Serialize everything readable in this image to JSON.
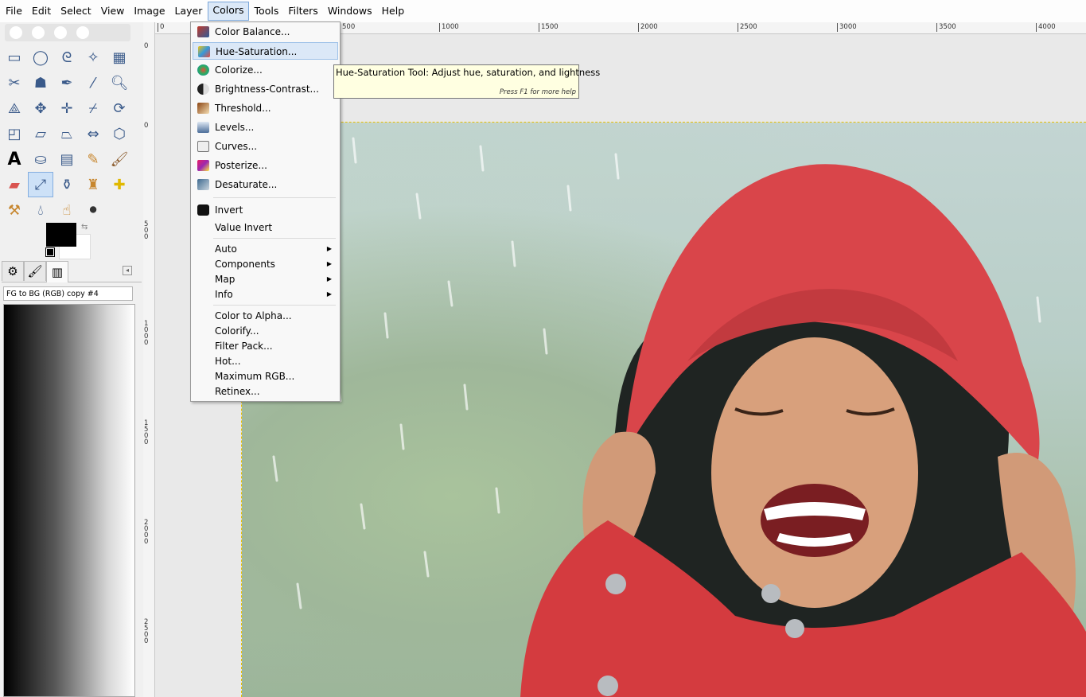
{
  "menubar": [
    "File",
    "Edit",
    "Select",
    "View",
    "Image",
    "Layer",
    "Colors",
    "Tools",
    "Filters",
    "Windows",
    "Help"
  ],
  "ruler_h": [
    "0",
    "500",
    "1000",
    "1500",
    "2000",
    "2500",
    "3000",
    "3500",
    "4000"
  ],
  "ruler_v": [
    "0",
    "500",
    "1000",
    "1500",
    "2000",
    "2500"
  ],
  "gradient": {
    "name": "FG to BG (RGB) copy #4"
  },
  "colors_menu": [
    {
      "label": "Color Balance...",
      "icon": "color-balance-icon",
      "color": "#c0392b"
    },
    {
      "label": "Hue-Saturation...",
      "icon": "hue-saturation-icon",
      "color": "#5a7fb0",
      "highlighted": true
    },
    {
      "label": "Colorize...",
      "icon": "colorize-icon",
      "color": "#d35400"
    },
    {
      "label": "Brightness-Contrast...",
      "icon": "brightness-contrast-icon",
      "color": "#555555"
    },
    {
      "label": "Threshold...",
      "icon": "threshold-icon",
      "color": "#a0522d"
    },
    {
      "label": "Levels...",
      "icon": "levels-icon",
      "color": "#4a6d99"
    },
    {
      "label": "Curves...",
      "icon": "curves-icon",
      "color": "#6b6b6b"
    },
    {
      "label": "Posterize...",
      "icon": "posterize-icon",
      "color": "#c2185b"
    },
    {
      "label": "Desaturate...",
      "icon": "desaturate-icon",
      "color": "#3e6a8f"
    },
    {
      "label": "Invert",
      "icon": "invert-icon",
      "color": "#111111"
    },
    {
      "label": "Value Invert",
      "icon": "",
      "color": ""
    },
    {
      "label": "Auto",
      "submenu": true
    },
    {
      "label": "Components",
      "submenu": true
    },
    {
      "label": "Map",
      "submenu": true
    },
    {
      "label": "Info",
      "submenu": true
    },
    {
      "label": "Color to Alpha..."
    },
    {
      "label": "Colorify..."
    },
    {
      "label": "Filter Pack..."
    },
    {
      "label": "Hot..."
    },
    {
      "label": "Maximum RGB..."
    },
    {
      "label": "Retinex..."
    }
  ],
  "tooltip": {
    "text": "Hue-Saturation Tool: Adjust hue, saturation, and lightness",
    "help": "Press F1 for more help"
  }
}
